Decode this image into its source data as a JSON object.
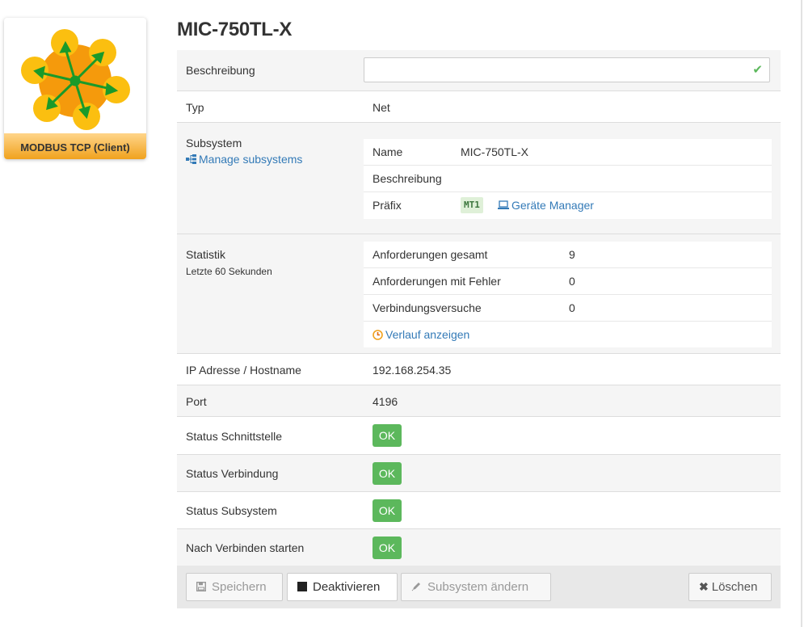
{
  "logo": {
    "label": "MODBUS TCP (Client)",
    "icon": "modbus-network-icon"
  },
  "title": "MIC-750TL-X",
  "fields": {
    "beschreibung": {
      "label": "Beschreibung",
      "value": "",
      "placeholder": ""
    },
    "typ": {
      "label": "Typ",
      "value": "Net"
    },
    "subsystem": {
      "label": "Subsystem",
      "manage_link": "Manage subsystems",
      "name_label": "Name",
      "name_value": "MIC-750TL-X",
      "desc_label": "Beschreibung",
      "desc_value": "",
      "prefix_label": "Präfix",
      "prefix_value": "MT1",
      "manager_link": "Geräte Manager"
    },
    "statistik": {
      "label": "Statistik",
      "sublabel": "Letzte 60 Sekunden",
      "rows": [
        {
          "label": "Anforderungen gesamt",
          "value": "9"
        },
        {
          "label": "Anforderungen mit Fehler",
          "value": "0"
        },
        {
          "label": "Verbindungsversuche",
          "value": "0"
        }
      ],
      "history_link": "Verlauf anzeigen"
    },
    "ip": {
      "label": "IP Adresse / Hostname",
      "value": "192.168.254.35"
    },
    "port": {
      "label": "Port",
      "value": "4196"
    },
    "status_schnittstelle": {
      "label": "Status Schnittstelle",
      "value": "OK"
    },
    "status_verbindung": {
      "label": "Status Verbindung",
      "value": "OK"
    },
    "status_subsystem": {
      "label": "Status Subsystem",
      "value": "OK"
    },
    "nach_verbinden": {
      "label": "Nach Verbinden starten",
      "value": "OK"
    }
  },
  "toolbar": {
    "save": "Speichern",
    "deactivate": "Deaktivieren",
    "change_subsystem": "Subsystem ändern",
    "delete": "Löschen"
  },
  "colors": {
    "ok": "#5cb85c",
    "link": "#337ab7",
    "logo_orange": "#f0a21e"
  }
}
